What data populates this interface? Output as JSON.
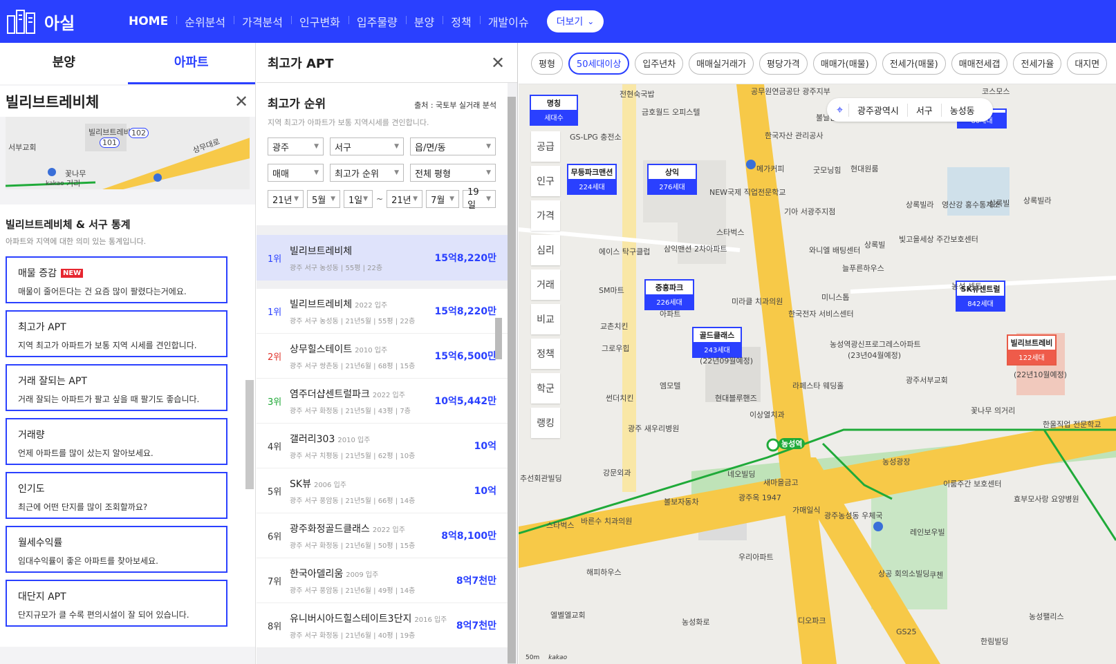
{
  "header": {
    "logo_text": "아실",
    "nav": [
      "HOME",
      "순위분석",
      "가격분석",
      "인구변화",
      "입주물량",
      "분양",
      "정책",
      "개발이슈"
    ],
    "more_label": "더보기"
  },
  "left_panel": {
    "tabs": [
      "분양",
      "아파트"
    ],
    "active_tab": "아파트",
    "complex_title": "빌리브트레비체",
    "minimap": {
      "labels": [
        "서부교회",
        "빌리브트레비체",
        "102",
        "101",
        "상무대로",
        "꽃나무",
        "거리",
        "kakao",
        "50m"
      ]
    },
    "stats_title": "빌리브트레비체 & 서구 통계",
    "stats_sub": "아파트와 지역에 대한 의미 있는 통계입니다.",
    "new_badge": "NEW",
    "cards": [
      {
        "title": "매물 증감",
        "desc": "매물이 줄어든다는 건 요즘 많이 팔렸다는거에요."
      },
      {
        "title": "최고가 APT",
        "desc": "지역 최고가 아파트가 보통 지역 시세를 견인합니다."
      },
      {
        "title": "거래 잘되는 APT",
        "desc": "거래 잘되는 아파트가 팔고 싶을 때 팔기도 좋습니다."
      },
      {
        "title": "거래량",
        "desc": "언제 아파트를 많이 샀는지 알아보세요."
      },
      {
        "title": "인기도",
        "desc": "최근에 어떤 단지를 많이 조회할까요?"
      },
      {
        "title": "월세수익률",
        "desc": "임대수익률이 좋은 아파트를 찾아보세요."
      },
      {
        "title": "대단지 APT",
        "desc": "단지규모가 클 수록 편의시설이 잘 되어 있습니다."
      }
    ]
  },
  "mid_panel": {
    "title": "최고가 APT",
    "rank_title": "최고가 순위",
    "source": "출처 : 국토부 실거래 분석",
    "rank_sub": "지역 최고가 아파트가 보통 지역시세를 견인합니다.",
    "filters_row1": [
      "광주",
      "서구",
      "읍/면/동"
    ],
    "filters_row2": [
      "매매",
      "최고가 순위",
      "전체 평형"
    ],
    "date_from": [
      "21년",
      "5월",
      "1일"
    ],
    "date_to": [
      "21년",
      "7월",
      "19일"
    ],
    "date_sep": "~",
    "highlight": {
      "rank": "1위",
      "name": "빌리브트레비체",
      "meta": "광주 서구 농성동 | 55평 | 22층",
      "price": "15억8,220만"
    },
    "items": [
      {
        "rank": "1위",
        "name": "빌리브트레비체",
        "year": "2022 입주",
        "meta": "광주 서구 농성동 | 21년5월 | 55평 | 22층",
        "price": "15억8,220만",
        "color": "blue"
      },
      {
        "rank": "2위",
        "name": "상무힐스테이트",
        "year": "2010 입주",
        "meta": "광주 서구 쌍촌동 | 21년6월 | 68평 | 15층",
        "price": "15억6,500만",
        "color": "red"
      },
      {
        "rank": "3위",
        "name": "염주더샵센트럴파크",
        "year": "2022 입주",
        "meta": "광주 서구 화정동 | 21년5월 | 43평 | 7층",
        "price": "10억5,442만",
        "color": "green"
      },
      {
        "rank": "4위",
        "name": "갤러리303",
        "year": "2010 입주",
        "meta": "광주 서구 치평동 | 21년5월 | 62평 | 10층",
        "price": "10억",
        "color": "dark"
      },
      {
        "rank": "5위",
        "name": "SK뷰",
        "year": "2006 입주",
        "meta": "광주 서구 풍암동 | 21년5월 | 66평 | 14층",
        "price": "10억",
        "color": "dark"
      },
      {
        "rank": "6위",
        "name": "광주화정골드클래스",
        "year": "2022 입주",
        "meta": "광주 서구 화정동 | 21년6월 | 50평 | 15층",
        "price": "8억8,100만",
        "color": "dark"
      },
      {
        "rank": "7위",
        "name": "한국아델리움",
        "year": "2009 입주",
        "meta": "광주 서구 풍암동 | 21년6월 | 49평 | 14층",
        "price": "8억7천만",
        "color": "dark"
      },
      {
        "rank": "8위",
        "name": "유니버시아드힐스테이트3단지",
        "year": "2016 입주",
        "meta": "광주 서구 화정동 | 21년6월 | 40평 | 19층",
        "price": "8억7천만",
        "color": "dark"
      }
    ]
  },
  "map": {
    "chips": [
      "평형",
      "50세대이상",
      "입주년차",
      "매매실거래가",
      "평당가격",
      "매매가(매물)",
      "전세가(매물)",
      "매매전세갭",
      "전세가율",
      "대지면"
    ],
    "active_chip": "50세대이상",
    "side_menu": [
      "공급",
      "인구",
      "가격",
      "심리",
      "거래",
      "비교",
      "정책",
      "학군",
      "랭킹"
    ],
    "location": [
      "광주광역시",
      "서구",
      "농성동"
    ],
    "apartments": [
      {
        "name": "명칭",
        "households": "세대수"
      },
      {
        "name": "무등파크맨션",
        "households": "224세대"
      },
      {
        "name": "상익",
        "households": "276세대"
      },
      {
        "name": "중흥파크",
        "households": "226세대"
      },
      {
        "name": "골드클래스",
        "households": "243세대"
      },
      {
        "name": "SK뷰센트럴",
        "households": "842세대"
      },
      {
        "name": "빌리브트레비",
        "households": "122세대"
      },
      {
        "name": "",
        "households": "80세대"
      }
    ],
    "labels": [
      "전현숙국밥",
      "금호월드 오피스텔",
      "GS-LPG 충전소",
      "공무원연금공단 광주지부",
      "한국자산 관리공사",
      "메가커피",
      "굿모닝힘",
      "현대원룸",
      "NEW국제 직업전문학교",
      "기아 서광주지점",
      "스타벅스",
      "삼익맨션 2차아파트",
      "에이스 탁구클럽",
      "SM마트",
      "교촌치킨",
      "그로우힙",
      "미라클 치과의원",
      "한국전자 서비스센터",
      "미니스톱",
      "와니엘 배팅센터",
      "늘푸른하우스",
      "상록빌라",
      "상록빌",
      "빛고을세상 주간보호센터",
      "영산강 홍수통제소",
      "상록빌",
      "농성역광신프로그레스아파트",
      "(23년04월예정)",
      "광주서부교회",
      "라페스타 웨딩홀",
      "엠모텔",
      "현대블루핸즈",
      "썬더치킨",
      "광주 새우리병원",
      "이상열치과",
      "농성역",
      "농성광장",
      "네오빌딩",
      "새마을금고",
      "광주옥 1947",
      "가매일식",
      "볼보자동차",
      "강문외과",
      "추선회관빌딩",
      "바른수 치과의원",
      "스타벅스",
      "우리아파트",
      "해피하우스",
      "광주농성동 우체국",
      "레인보우빌",
      "상공 회의소빌딩",
      "쿠첸",
      "이룸주간 보호센터",
      "효부모사랑 요양병원",
      "한울직업 전문학교",
      "꽃나무 의거리",
      "엘벨엘교회",
      "농성화로",
      "디오파크",
      "GS25",
      "한림빌딩",
      "농성팰리스",
      "(22년09월예정)",
      "(22년10월예정)",
      "코스모스",
      "불날은 노인복지센터",
      "아파트",
      "상록빌라",
      "농성 센트"
    ],
    "scale_label": "50m",
    "kakao": "kakao"
  },
  "colors": {
    "brand": "#2a40ff",
    "road_yellow": "#f7c948",
    "subway_green": "#1faa39",
    "red_accent": "#ef5b4a"
  }
}
